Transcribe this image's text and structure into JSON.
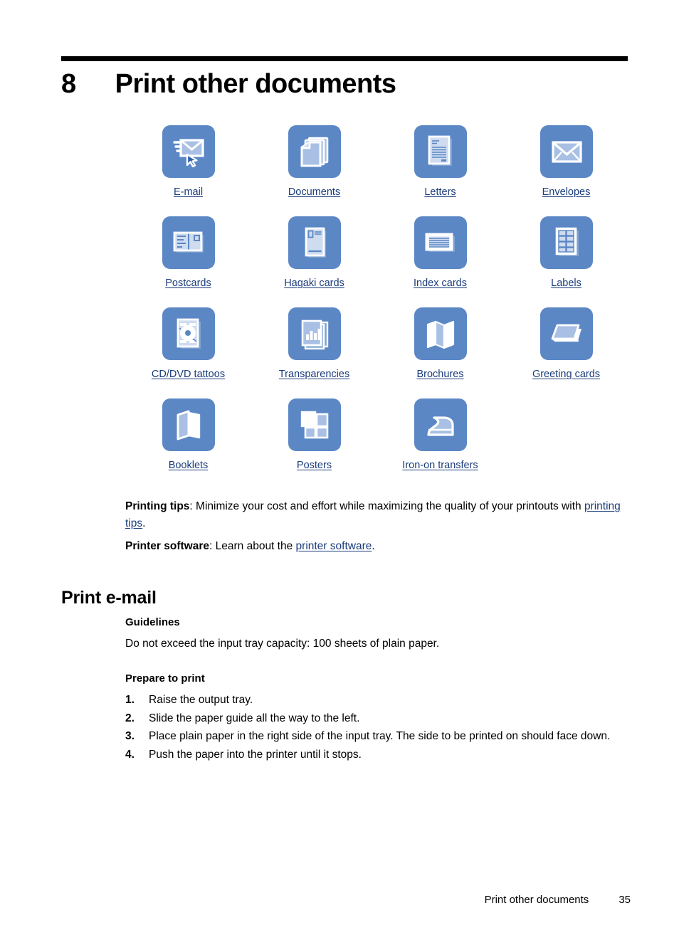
{
  "chapter": {
    "number": "8",
    "title": "Print other documents"
  },
  "icon_grid": {
    "rows": [
      [
        {
          "label": "E-mail",
          "icon": "email-with-cursor-icon"
        },
        {
          "label": "Documents",
          "icon": "stacked-documents-icon"
        },
        {
          "label": "Letters",
          "icon": "letter-page-icon"
        },
        {
          "label": "Envelopes",
          "icon": "envelope-icon"
        }
      ],
      [
        {
          "label": "Postcards",
          "icon": "postcard-icon"
        },
        {
          "label": "Hagaki cards",
          "icon": "hagaki-card-icon"
        },
        {
          "label": "Index cards",
          "icon": "index-card-icon"
        },
        {
          "label": "Labels",
          "icon": "label-sheet-icon"
        }
      ],
      [
        {
          "label": "CD/DVD tattoos",
          "icon": "cd-dvd-tattoo-icon"
        },
        {
          "label": "Transparencies",
          "icon": "transparencies-icon"
        },
        {
          "label": "Brochures",
          "icon": "brochure-fold-icon"
        },
        {
          "label": "Greeting cards",
          "icon": "greeting-card-icon"
        }
      ],
      [
        {
          "label": "Booklets",
          "icon": "booklet-icon"
        },
        {
          "label": "Posters",
          "icon": "poster-tiles-icon"
        },
        {
          "label": "Iron-on transfers",
          "icon": "iron-icon"
        },
        {
          "label": "",
          "icon": ""
        }
      ]
    ]
  },
  "intro": {
    "printing_tips_label": "Printing tips",
    "printing_tips_text": ": Minimize your cost and effort while maximizing the quality of your printouts with ",
    "printing_tips_link": "printing tips",
    "printing_tips_end": ".",
    "printer_software_label": "Printer software",
    "printer_software_text": ": Learn about the ",
    "printer_software_link": "printer software",
    "printer_software_end": "."
  },
  "section": {
    "heading": "Print e-mail",
    "guidelines_title": "Guidelines",
    "guidelines_text": "Do not exceed the input tray capacity: 100 sheets of plain paper.",
    "prepare_title": "Prepare to print",
    "steps": [
      {
        "num": "1.",
        "text": "Raise the output tray."
      },
      {
        "num": "2.",
        "text": "Slide the paper guide all the way to the left."
      },
      {
        "num": "3.",
        "text": "Place plain paper in the right side of the input tray. The side to be printed on should face down."
      },
      {
        "num": "4.",
        "text": "Push the paper into the printer until it stops."
      }
    ]
  },
  "footer": {
    "title": "Print other documents",
    "page": "35"
  },
  "colors": {
    "icon_tile_blue": "#5b87c5",
    "link_navy": "#1a3c7a",
    "glyph_white": "#ffffff",
    "glyph_fill": "#a9c0e4"
  }
}
